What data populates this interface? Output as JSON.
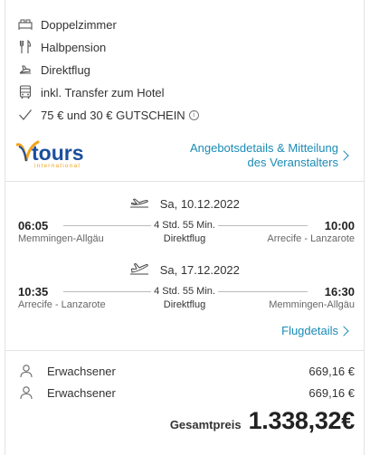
{
  "features": [
    {
      "icon": "bed-icon",
      "label": "Doppelzimmer"
    },
    {
      "icon": "cutlery-icon",
      "label": "Halbpension"
    },
    {
      "icon": "plane-icon",
      "label": "Direktflug"
    },
    {
      "icon": "bus-icon",
      "label": "inkl. Transfer zum Hotel"
    },
    {
      "icon": "checkmark-icon",
      "label": "75 € und 30 € GUTSCHEIN",
      "info": "i"
    }
  ],
  "operator": {
    "logo_text": "tours",
    "logo_subtext": "international",
    "link_line1": "Angebotsdetails & Mitteilung",
    "link_line2": "des Veranstalters"
  },
  "flights": [
    {
      "date": "Sa, 10.12.2022",
      "dep_time": "06:05",
      "dep_place": "Memmingen-Allgäu",
      "duration": "4 Std. 55 Min.",
      "type": "Direktflug",
      "arr_time": "10:00",
      "arr_place": "Arrecife - Lanzarote"
    },
    {
      "date": "Sa, 17.12.2022",
      "dep_time": "10:35",
      "dep_place": "Arrecife - Lanzarote",
      "duration": "4 Std. 55 Min.",
      "type": "Direktflug",
      "arr_time": "16:30",
      "arr_place": "Memmingen-Allgäu"
    }
  ],
  "flight_details_link": "Flugdetails",
  "passengers": [
    {
      "type": "Erwachsener",
      "price": "669,16 €"
    },
    {
      "type": "Erwachsener",
      "price": "669,16 €"
    }
  ],
  "total": {
    "label": "Gesamtpreis",
    "value": "1.338,32€"
  },
  "colors": {
    "link": "#1a8bb5",
    "logo_blue": "#1b4f9c",
    "logo_orange": "#f2a31b"
  }
}
